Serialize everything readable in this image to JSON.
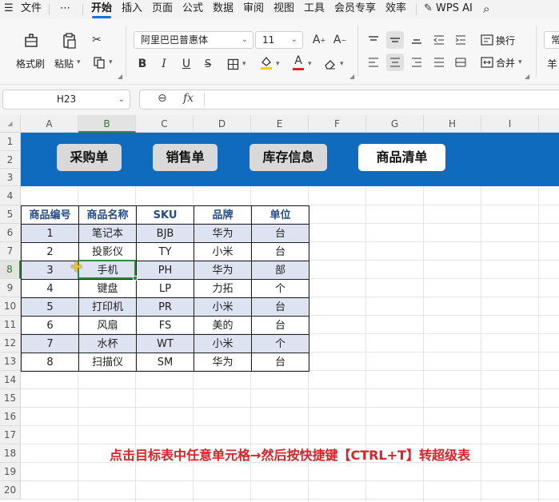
{
  "menu": {
    "file_label": "文件",
    "more_label": "⋯",
    "tabs": [
      "开始",
      "插入",
      "页面",
      "公式",
      "数据",
      "审阅",
      "视图",
      "工具",
      "会员专享",
      "效率"
    ],
    "active_tab": "开始",
    "wps_ai_label": "WPS AI"
  },
  "ribbon": {
    "format_painter_label": "格式刷",
    "paste_label": "粘贴",
    "font_name": "阿里巴巴普惠体",
    "font_size": "11",
    "wrap_label": "换行",
    "merge_label": "合并",
    "partial_right": "常",
    "partial_right2": "羊",
    "bold": "B",
    "italic": "I",
    "underline": "U",
    "font_color_letter": "A",
    "font_color": "#e21f25",
    "fill_color": "#f5d000"
  },
  "formula_bar": {
    "cell_ref": "H23",
    "fx_label": "fx",
    "content": ""
  },
  "sheet": {
    "columns": [
      "A",
      "B",
      "C",
      "D",
      "E",
      "F",
      "G",
      "H",
      "I"
    ],
    "selected_column": "B",
    "rows": [
      "1",
      "2",
      "3",
      "4",
      "5",
      "6",
      "7",
      "8",
      "9",
      "10",
      "11",
      "12",
      "13",
      "14",
      "15",
      "16",
      "17",
      "18",
      "19",
      "20"
    ],
    "selected_row": "8",
    "nav_buttons": [
      "采购单",
      "销售单",
      "库存信息",
      "商品清单"
    ],
    "current_nav": "商品清单",
    "table_headers": [
      "商品编号",
      "商品名称",
      "SKU",
      "品牌",
      "单位"
    ],
    "table_rows": [
      [
        "1",
        "笔记本",
        "BJB",
        "华为",
        "台"
      ],
      [
        "2",
        "投影仪",
        "TY",
        "小米",
        "台"
      ],
      [
        "3",
        "手机",
        "PH",
        "华为",
        "部"
      ],
      [
        "4",
        "键盘",
        "LP",
        "力拓",
        "个"
      ],
      [
        "5",
        "打印机",
        "PR",
        "小米",
        "台"
      ],
      [
        "6",
        "风扇",
        "FS",
        "美的",
        "台"
      ],
      [
        "7",
        "水杯",
        "WT",
        "小米",
        "个"
      ],
      [
        "8",
        "扫描仪",
        "SM",
        "华为",
        "台"
      ]
    ],
    "banner_color": "#0f6bbd",
    "band_color": "#dde3f1",
    "header_text_color": "#244b8a",
    "instruction": "点击目标表中任意单元格→然后按快捷键【CTRL+T】转超级表"
  }
}
